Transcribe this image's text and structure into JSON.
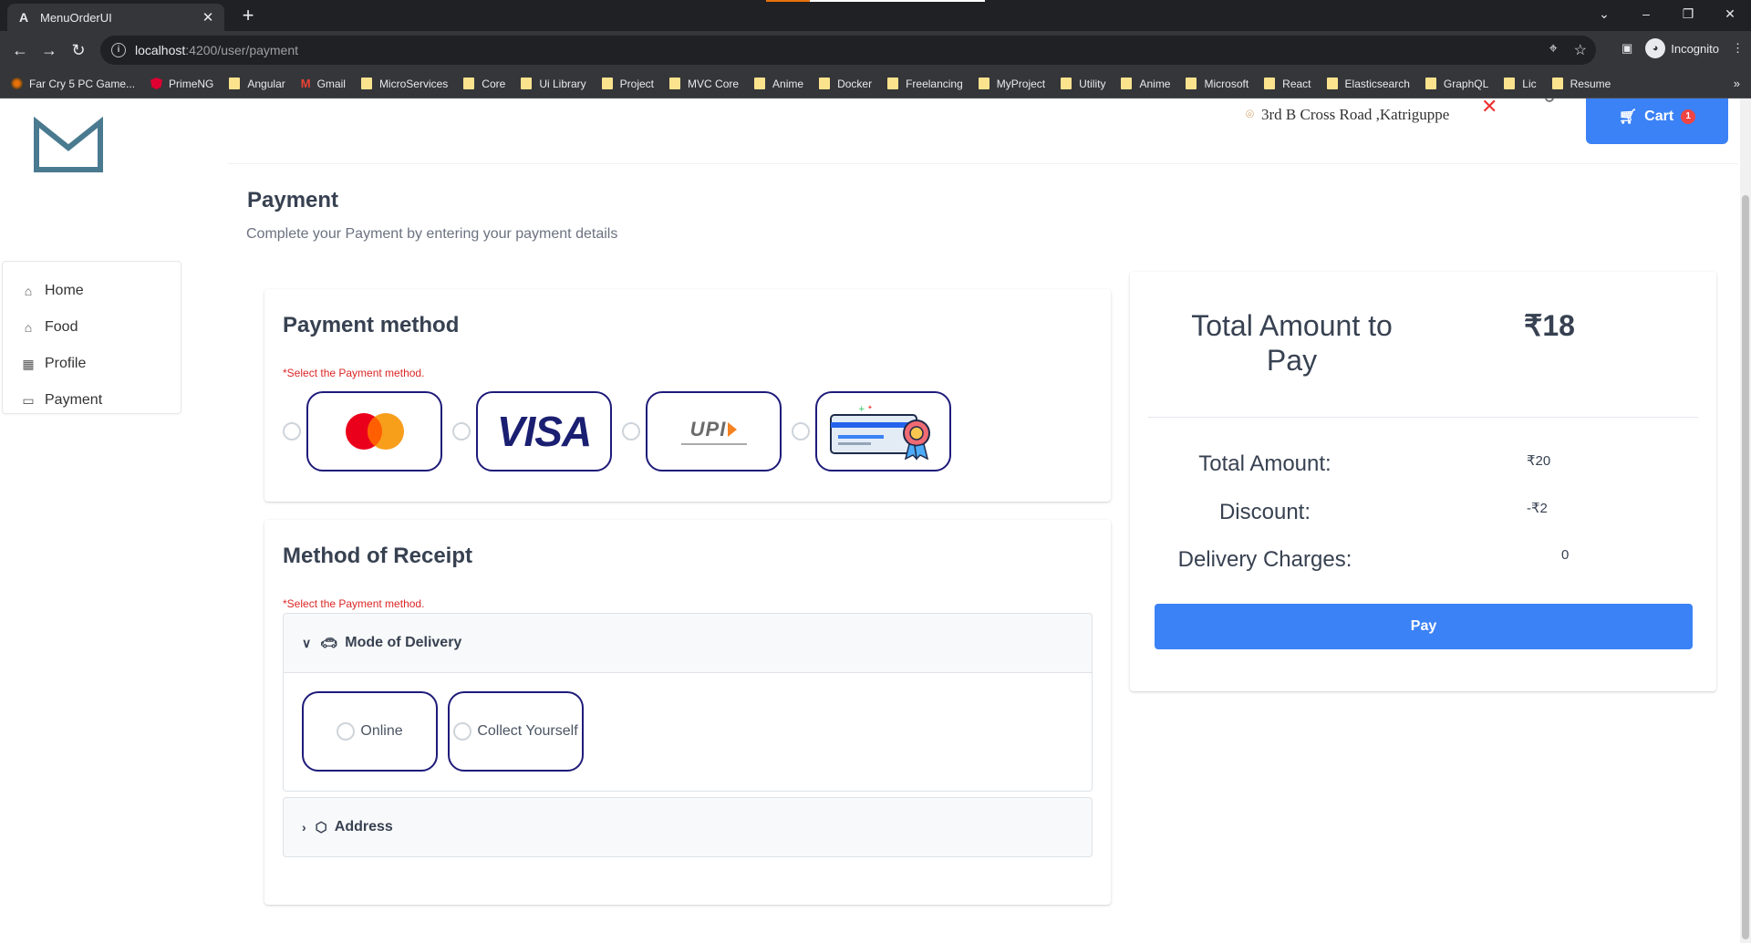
{
  "browser": {
    "tab_title": "MenuOrderUI",
    "tab_favicon": "A",
    "url_host": "localhost",
    "url_path": ":4200/user/payment",
    "incognito_label": "Incognito",
    "bookmarks": [
      "Far Cry 5 PC Game...",
      "PrimeNG",
      "Angular",
      "Gmail",
      "MicroServices",
      "Core",
      "Ui Library",
      "Project",
      "MVC Core",
      "Anime",
      "Docker",
      "Freelancing",
      "MyProject",
      "Utility",
      "Anime",
      "Microsoft",
      "React",
      "Elasticsearch",
      "GraphQL",
      "Lic",
      "Resume"
    ]
  },
  "header": {
    "location": "3rd B Cross Road ,Katriguppe",
    "cart_label": "Cart",
    "cart_count": "1"
  },
  "sidebar": {
    "items": [
      {
        "label": "Home",
        "icon": "home-icon"
      },
      {
        "label": "Food",
        "icon": "home-icon"
      },
      {
        "label": "Profile",
        "icon": "calendar-icon"
      },
      {
        "label": "Payment",
        "icon": "credit-card-icon"
      }
    ]
  },
  "page": {
    "title": "Payment",
    "subtitle": "Complete your Payment by entering your payment details"
  },
  "payment_method": {
    "heading": "Payment method",
    "required_note": "*Select the Payment method.",
    "options": [
      "mastercard",
      "visa",
      "upi",
      "card"
    ],
    "visa_text": "VISA",
    "upi_text": "UPI"
  },
  "receipt": {
    "heading": "Method of Receipt",
    "required_note": "*Select the Payment method.",
    "delivery_panel": {
      "title": "Mode of Delivery",
      "options": [
        "Online",
        "Collect Yourself"
      ]
    },
    "address_panel": {
      "title": "Address"
    }
  },
  "summary": {
    "total_label": "Total Amount to Pay",
    "total_value": "₹18",
    "rows": [
      {
        "label": "Total Amount:",
        "value": "₹20"
      },
      {
        "label": "Discount:",
        "value": "-₹2"
      },
      {
        "label": "Delivery Charges:",
        "value": "0"
      }
    ],
    "pay_label": "Pay"
  },
  "colors": {
    "primary": "#3b82f6",
    "option_border": "#1e1b7a",
    "required": "#dc2626"
  }
}
